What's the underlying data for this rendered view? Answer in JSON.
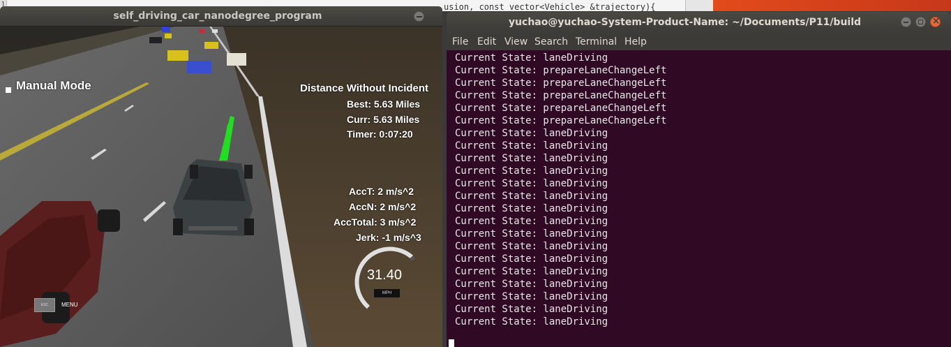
{
  "background_editor": {
    "gutter": "]",
    "code_snippet": "usion, const vector<Vehicle> &trajectory){"
  },
  "simulator": {
    "window_title": "self_driving_car_nanodegree_program",
    "hud": {
      "mode": "Manual Mode",
      "distance_title": "Distance Without Incident",
      "best": "Best: 5.63 Miles",
      "curr": "Curr: 5.63 Miles",
      "timer": "Timer: 0:07:20",
      "acc_t": "AccT: 2 m/s^2",
      "acc_n": "AccN: 2 m/s^2",
      "acc_total": "AccTotal: 3 m/s^2",
      "jerk": "Jerk: -1 m/s^3",
      "speed": "31.40",
      "speed_unit": "MPH",
      "esc": "ESC",
      "menu": "MENU"
    }
  },
  "terminal": {
    "window_title": "yuchao@yuchao-System-Product-Name: ~/Documents/P11/build",
    "menu": [
      "File",
      "Edit",
      "View",
      "Search",
      "Terminal",
      "Help"
    ],
    "lines": [
      "Current State: laneDriving",
      "Current State: prepareLaneChangeLeft",
      "Current State: prepareLaneChangeLeft",
      "Current State: prepareLaneChangeLeft",
      "Current State: prepareLaneChangeLeft",
      "Current State: prepareLaneChangeLeft",
      "Current State: laneDriving",
      "Current State: laneDriving",
      "Current State: laneDriving",
      "Current State: laneDriving",
      "Current State: laneDriving",
      "Current State: laneDriving",
      "Current State: laneDriving",
      "Current State: laneDriving",
      "Current State: laneDriving",
      "Current State: laneDriving",
      "Current State: laneDriving",
      "Current State: laneDriving",
      "Current State: laneDriving",
      "Current State: laneDriving",
      "Current State: laneDriving",
      "Current State: laneDriving"
    ]
  },
  "colors": {
    "terminal_bg": "#300a24",
    "path_green": "#22dd22",
    "close_button": "#e9683a"
  }
}
